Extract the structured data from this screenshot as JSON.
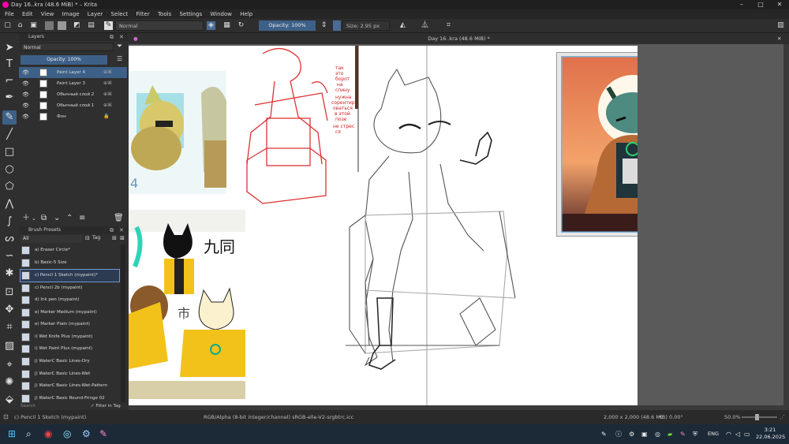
{
  "window": {
    "title": "Day 16..kra (48.6 MiB) * – Krita",
    "controls": [
      "–",
      "□",
      "✕"
    ]
  },
  "menu": [
    "File",
    "Edit",
    "View",
    "Image",
    "Layer",
    "Select",
    "Filter",
    "Tools",
    "Settings",
    "Window",
    "Help"
  ],
  "toolbar": {
    "blend_mode": "Normal",
    "opacity_label": "Opacity: 100%",
    "size_label": "Size: 2.95 px"
  },
  "layers_docker": {
    "title": "Layers",
    "blend_mode": "Normal",
    "opacity_label": "Opacity:  100%",
    "layers": [
      {
        "name": "Paint Layer 4",
        "selected": true
      },
      {
        "name": "Paint Layer 3",
        "selected": false
      },
      {
        "name": "Обычный слой 2",
        "selected": false
      },
      {
        "name": "Обычный слой 1",
        "selected": false
      },
      {
        "name": "Фон",
        "selected": false
      }
    ]
  },
  "brush_presets": {
    "title": "Brush Presets",
    "filter": "All",
    "tag_label": "Tag",
    "search_placeholder": "Search",
    "filter_in_tag": "Filter in Tag",
    "items": [
      "a) Eraser Circle*",
      "b) Basic-5 Size",
      "c) Pencil 1 Sketch (mypaint)*",
      "c) Pencil 2b (mypaint)",
      "d) Ink pen (mypaint)",
      "e) Marker Medium (mypaint)",
      "e) Marker Plain (mypaint)",
      "i) Wet Knife Plus (mypaint)",
      "i) Wet Paint Plus (mypaint)",
      "j) WaterC Basic Lines-Dry",
      "j) WaterC Basic Lines-Wet",
      "j) WaterC Basic Lines-Wet-Pattern",
      "j) WaterC Basic Round-Fringe 02"
    ],
    "selected_index": 2
  },
  "document_tab": "Day 16..kra (48.6 MiB) *",
  "canvas": {
    "chinese_text": "九同",
    "annotation_lines": [
      "так",
      "это",
      "борот",
      "на",
      "спину",
      "нужна",
      "сорентир",
      "оваться",
      "в этой",
      "позе",
      "не стрес",
      "ся"
    ]
  },
  "status": {
    "current_brush": "c) Pencil 1 Sketch (mypaint)",
    "color_info": "RGB/Alpha (8-bit integer/channel)  sRGB-elle-V2-srgbtrc.icc",
    "doc_size": "2,000 x 2,000 (48.6 MiB)",
    "rotation": "0.00°",
    "zoom": "50.0%"
  },
  "taskbar": {
    "lang": "ENG",
    "time": "3:21",
    "date": "22.06.2025"
  }
}
